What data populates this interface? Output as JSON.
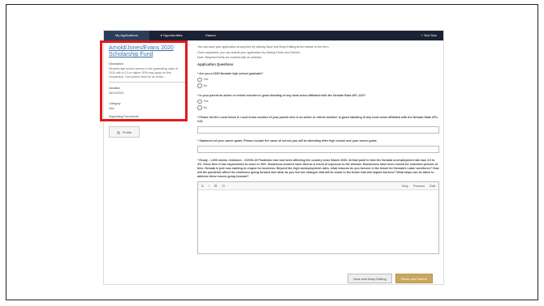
{
  "nav": {
    "items": [
      "My Applications",
      "▾ Opportunities",
      "Games"
    ],
    "right": "+ Text Size"
  },
  "sidebar": {
    "title": "Arnold/Jones/Evans 2020 Scholarship Fund",
    "description_label": "Description",
    "description": "Nevada high school seniors in the graduating class of 2020 with a 3.0 or higher GPA may apply for this scholarship. One parent must be an active…",
    "deadline_label": "Deadline",
    "deadline": "06/13/2020",
    "category_label": "Category",
    "category": "Nao",
    "supporting_label": "Supporting Documents",
    "profile_label": "Profile"
  },
  "main": {
    "intro": [
      "You can save your application at any time by clicking Save and Keep Editing at the bottom of the form.",
      "Once completed, you can submit your application by clicking Finish and Submit.",
      "Note: Required fields are marked with an asterisk."
    ],
    "section_title": "Application Questions",
    "q1": "* Are you a 2020 Nevada high school graduate?",
    "q2": "* Is your parent an active or retired member in good standing of any local union affiliated with the Nevada State AFL-CIO?",
    "yes": "Yes",
    "no": "No",
    "q3": "* Please list the Local Union & Local Union number of your parent who is an active or retired member in good standing of any local union affiliated with the Nevada State AFL-CIO.",
    "q4": "* Statement of your career goals. Please include the name of school you will be attending after high school and your career goals.",
    "q5": "* Essay - 1,000 words, minimum - COVID-19 Pandemic has now been affecting the country since March 2020. At that point in time the Nevada unemployment rate was 3.5 to 4%. Since then it has skyrocketed to close to 30%. Numerous workers have died as a result of exposure to the disease. Businesses have been closed for extended periods of time. Nevada is just now starting to reopen for business. Beyond the high unemployment rates, what reasons do you foresee in the future for Nevada's Labor workforce? How will the pandemic affect the workforce going forward and what do you feel are changes that will be made in the future that will impact workers? What steps can be taken to address these issues going forward?",
    "editor_tools": [
      "B",
      "I",
      "☰",
      "☷"
    ],
    "editor_modes": [
      "Help",
      "Preview",
      "Edit"
    ]
  },
  "buttons": {
    "save": "Save and Keep Editing",
    "submit": "Finish and Submit"
  },
  "colors": {
    "highlight": "#e11b1b",
    "nav_bg": "#1a2233",
    "link": "#3b6ea5",
    "submit": "#c9a85c"
  }
}
